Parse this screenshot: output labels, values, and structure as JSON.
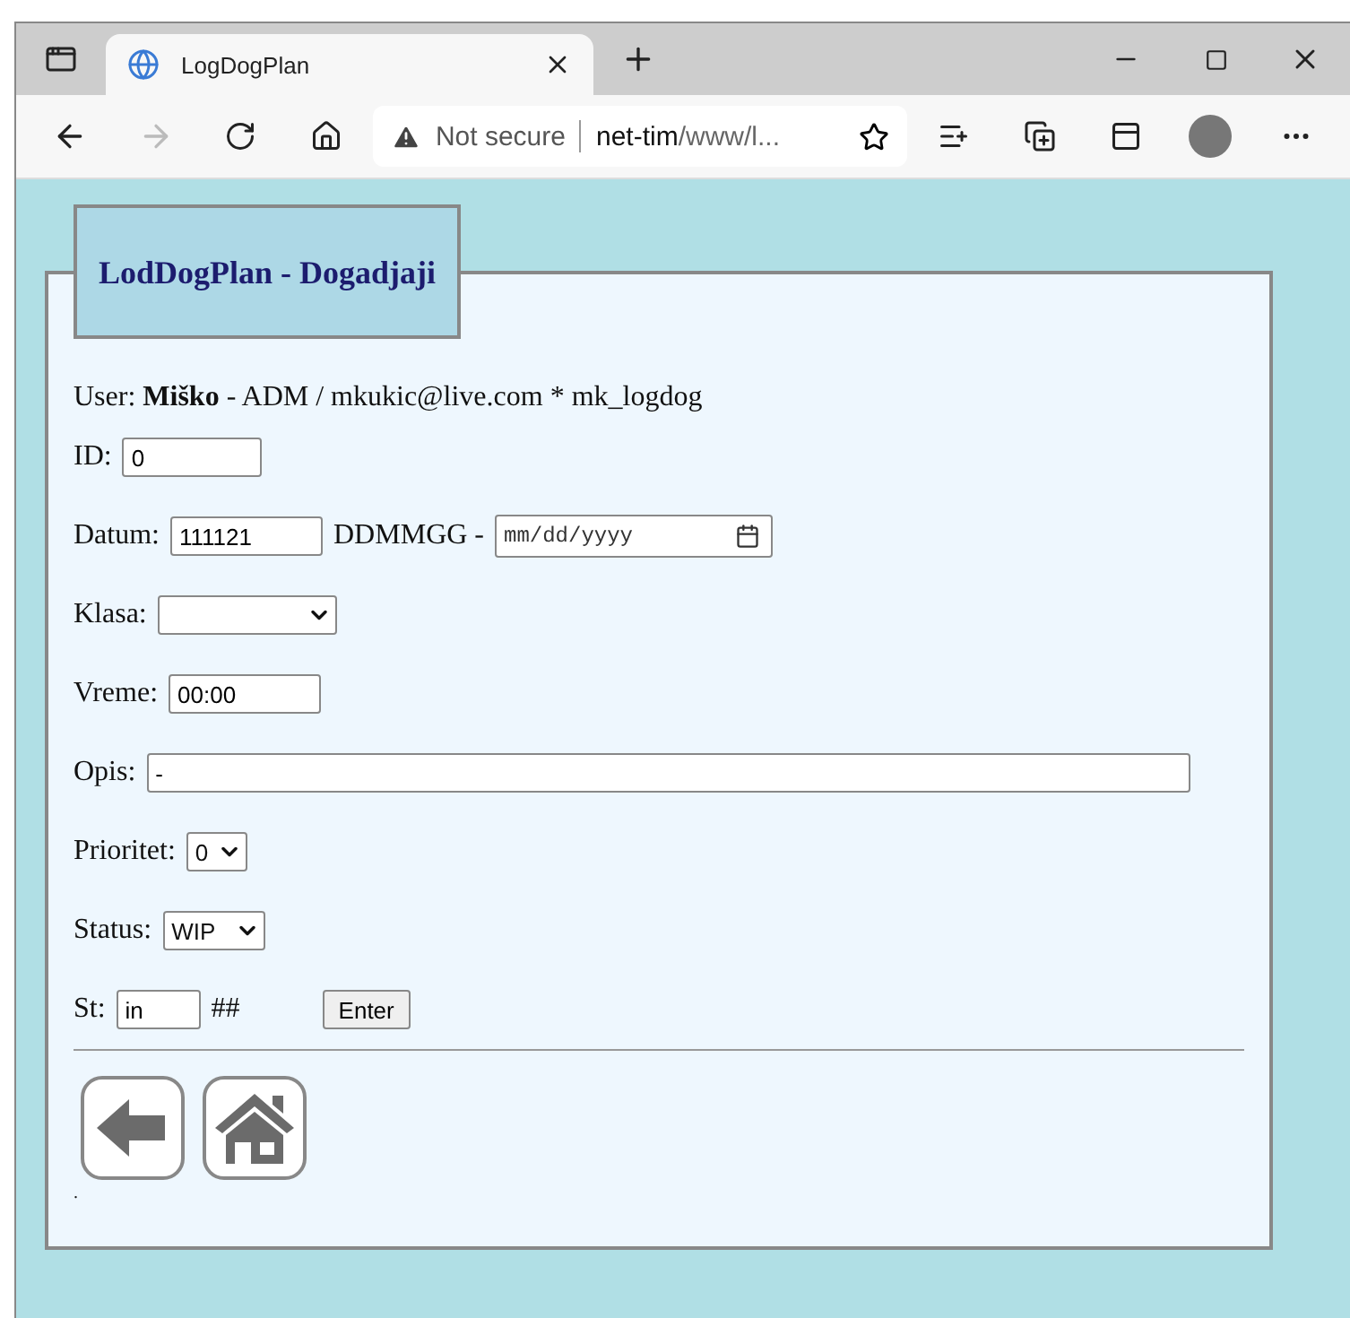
{
  "browser": {
    "tab_title": "LogDogPlan",
    "url_warning": "Not secure",
    "url_host": "net-tim",
    "url_path": "/www/l..."
  },
  "form": {
    "legend": "LodDogPlan - Dogadjaji",
    "user_line": "User: **Miško** - ADM / mkukic@live.com * mk_logdog",
    "fields": [
      {
        "kind": "text",
        "label": "ID:",
        "value": "0"
      },
      {
        "kind": "date",
        "label": "Datum:",
        "value": "111121",
        "hint": "DDMMGG -",
        "date_placeholder": "mm/dd/yyyy"
      },
      {
        "kind": "select",
        "label": "Klasa:"
      },
      {
        "kind": "text",
        "label": "Vreme:",
        "value": "00:00"
      },
      {
        "kind": "text",
        "label": "Opis:",
        "value": "-"
      },
      {
        "kind": "select",
        "label": "Prioritet:",
        "value": "0"
      },
      {
        "kind": "select",
        "label": "Status:",
        "value": "WIP"
      },
      {
        "kind": "submit",
        "label": "St:",
        "value": "in",
        "hint": "##",
        "button": "Enter"
      }
    ],
    "footer_mark": "."
  }
}
